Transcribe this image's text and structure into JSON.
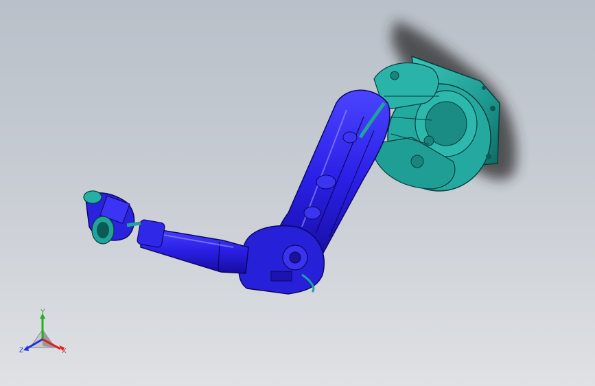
{
  "view": {
    "background_top": "#b9c0c9",
    "background_bottom": "#dfe1e4"
  },
  "model": {
    "colors": {
      "arm_blue": "#2b22e0",
      "arm_dark": "#120a8a",
      "base_teal": "#1fa39a",
      "base_dark": "#0c5a55",
      "shadow": "#2b2b2b"
    }
  },
  "triad": {
    "x_label": "X",
    "y_label": "Y",
    "z_label": "Z",
    "x_color": "#e02020",
    "y_color": "#20b020",
    "z_color": "#2030e0"
  }
}
